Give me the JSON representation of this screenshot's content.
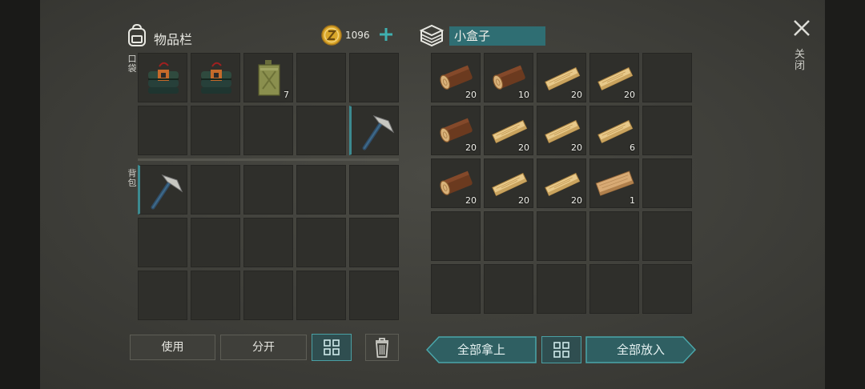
{
  "inventory": {
    "title": "物品栏",
    "coins": "1096",
    "pocket_label": "口袋",
    "backpack_label": "背包",
    "pocket_rows": [
      [
        {
          "item": "dynamite-bundle-icon",
          "qty": ""
        },
        {
          "item": "dynamite-bundle-icon",
          "qty": ""
        },
        {
          "item": "jerrycan-icon",
          "qty": "7"
        },
        {
          "item": "",
          "qty": ""
        },
        {
          "item": "",
          "qty": ""
        }
      ],
      [
        {
          "item": "",
          "qty": ""
        },
        {
          "item": "",
          "qty": ""
        },
        {
          "item": "",
          "qty": ""
        },
        {
          "item": "",
          "qty": ""
        },
        {
          "item": "pickaxe-icon",
          "qty": "",
          "equipped": true
        }
      ]
    ],
    "backpack_rows": [
      [
        {
          "item": "pickaxe-icon",
          "qty": "",
          "equipped": true
        },
        {
          "item": "",
          "qty": ""
        },
        {
          "item": "",
          "qty": ""
        },
        {
          "item": "",
          "qty": ""
        },
        {
          "item": "",
          "qty": ""
        }
      ],
      [
        {
          "item": "",
          "qty": ""
        },
        {
          "item": "",
          "qty": ""
        },
        {
          "item": "",
          "qty": ""
        },
        {
          "item": "",
          "qty": ""
        },
        {
          "item": "",
          "qty": ""
        }
      ],
      [
        {
          "item": "",
          "qty": ""
        },
        {
          "item": "",
          "qty": ""
        },
        {
          "item": "",
          "qty": ""
        },
        {
          "item": "",
          "qty": ""
        },
        {
          "item": "",
          "qty": ""
        }
      ]
    ],
    "buttons": {
      "use": "使用",
      "split": "分开"
    }
  },
  "container": {
    "name": "小盒子",
    "rows": [
      [
        {
          "item": "log-icon",
          "qty": "20"
        },
        {
          "item": "log-icon",
          "qty": "10"
        },
        {
          "item": "plank-icon",
          "qty": "20"
        },
        {
          "item": "plank-icon",
          "qty": "20"
        },
        {
          "item": "",
          "qty": ""
        }
      ],
      [
        {
          "item": "log-icon",
          "qty": "20"
        },
        {
          "item": "plank-icon",
          "qty": "20"
        },
        {
          "item": "plank-icon",
          "qty": "20"
        },
        {
          "item": "plank-icon",
          "qty": "6"
        },
        {
          "item": "",
          "qty": ""
        }
      ],
      [
        {
          "item": "log-icon",
          "qty": "20"
        },
        {
          "item": "plank-icon",
          "qty": "20"
        },
        {
          "item": "plank-icon",
          "qty": "20"
        },
        {
          "item": "board-icon",
          "qty": "1"
        },
        {
          "item": "",
          "qty": ""
        }
      ],
      [
        {
          "item": "",
          "qty": ""
        },
        {
          "item": "",
          "qty": ""
        },
        {
          "item": "",
          "qty": ""
        },
        {
          "item": "",
          "qty": ""
        },
        {
          "item": "",
          "qty": ""
        }
      ],
      [
        {
          "item": "",
          "qty": ""
        },
        {
          "item": "",
          "qty": ""
        },
        {
          "item": "",
          "qty": ""
        },
        {
          "item": "",
          "qty": ""
        },
        {
          "item": "",
          "qty": ""
        }
      ]
    ],
    "buttons": {
      "take_all": "全部拿上",
      "put_all": "全部放入"
    }
  },
  "close_label": "关闭",
  "colors": {
    "accent": "#3c8a90",
    "slot_bg": "#2f2f2b",
    "coin": "#d9a62a"
  }
}
